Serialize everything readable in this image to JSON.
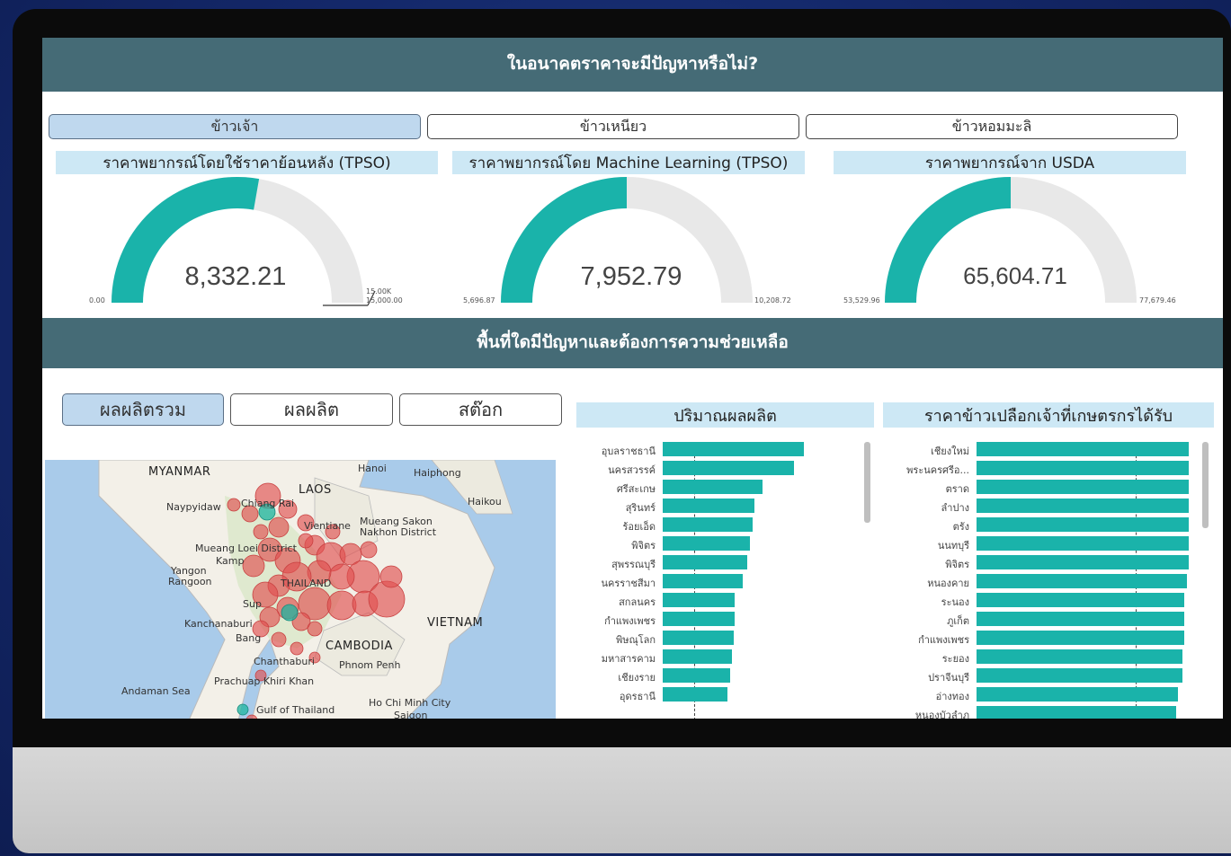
{
  "header": {
    "title": "ในอนาคตราคาจะมีปัญหาหรือไม่?"
  },
  "rice_tabs": [
    "ข้าวเจ้า",
    "ข้าวเหนียว",
    "ข้าวหอมมะลิ"
  ],
  "gauges": [
    {
      "title": "ราคาพยากรณ์โดยใช้ราคาย้อนหลัง (TPSO)",
      "value": "8,332.21",
      "min": "0.00",
      "max": "15,000.00",
      "target": "15.00K",
      "fill": 0.555
    },
    {
      "title": "ราคาพยากรณ์โดย Machine Learning (TPSO)",
      "value": "7,952.79",
      "min": "5,696.87",
      "max": "10,208.72",
      "fill": 0.5
    },
    {
      "title": "ราคาพยากรณ์จาก USDA",
      "value": "65,604.71",
      "min": "53,529.96",
      "max": "77,679.46",
      "fill": 0.5
    }
  ],
  "section2": {
    "title": "พื้นที่ใดมีปัญหาและต้องการความช่วยเหลือ"
  },
  "segment_tabs": [
    "ผลผลิตรวม",
    "ผลผลิต",
    "สต๊อก"
  ],
  "map": {
    "countries": [
      "MYANMAR",
      "LAOS",
      "VIETNAM",
      "CAMBODIA"
    ],
    "places": [
      "Hanoi",
      "Haiphong",
      "Haikou",
      "Naypyidaw",
      "Chiang Rai",
      "Vientiane",
      "Mueang Sakon Nakhon District",
      "Mueang Loei District",
      "Kamp",
      "Yangon",
      "Rangoon",
      "THAILAND",
      "Sup",
      "Kanchanaburi",
      "Bang",
      "Chanthaburi",
      "Phnom Penh",
      "Prachuap Khiri Khan",
      "Andaman Sea",
      "Gulf of Thailand",
      "Ho Chi Minh City",
      "Saigon"
    ]
  },
  "charts": [
    {
      "title": "ปริมาณผลผลิต",
      "chart_data": {
        "type": "bar",
        "categories": [
          "อุบลราชธานี",
          "นครสวรรค์",
          "ศรีสะเกษ",
          "สุรินทร์",
          "ร้อยเอ็ด",
          "พิจิตร",
          "สุพรรณบุรี",
          "นครราชสีมา",
          "สกลนคร",
          "กำแพงเพชร",
          "พิษณุโลก",
          "มหาสารคาม",
          "เชียงราย",
          "อุดรธานี"
        ],
        "values": [
          100,
          93,
          71,
          65,
          64,
          62,
          60,
          57,
          51,
          51,
          50,
          49,
          48,
          46
        ]
      }
    },
    {
      "title": "ราคาข้าวเปลือกเจ้าที่เกษตรกรได้รับ",
      "chart_data": {
        "type": "bar",
        "categories": [
          "เชียงใหม่",
          "พระนครศรีอ...",
          "ตราด",
          "ลำปาง",
          "ตรัง",
          "นนทบุรี",
          "พิจิตร",
          "หนองคาย",
          "ระนอง",
          "ภูเก็ต",
          "กำแพงเพชร",
          "ระยอง",
          "ปราจีนบุรี",
          "อ่างทอง",
          "หนองบัวลำภู"
        ],
        "values": [
          100,
          100,
          100,
          100,
          100,
          100,
          100,
          99,
          98,
          98,
          98,
          97,
          97,
          95,
          94
        ]
      }
    }
  ]
}
